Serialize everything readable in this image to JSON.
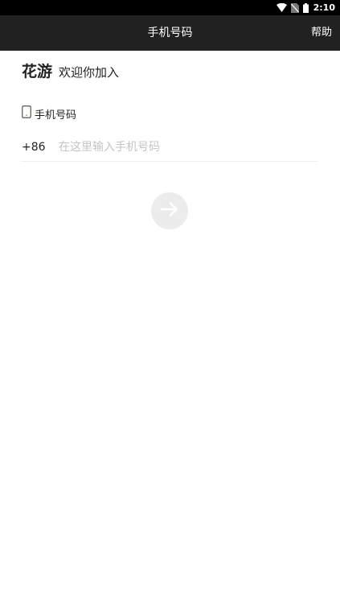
{
  "status_bar": {
    "time": "2:10",
    "icons": [
      "wifi-icon",
      "no-sim-icon",
      "battery-icon"
    ]
  },
  "nav": {
    "title": "手机号码",
    "help_label": "帮助",
    "background": "#212121"
  },
  "welcome": {
    "brand": "花游",
    "text": "欢迎你加入"
  },
  "phone_field": {
    "label": "手机号码",
    "icon": "phone-icon",
    "country_code": "+86",
    "placeholder": "在这里输入手机号码",
    "value": ""
  },
  "next_button": {
    "icon": "arrow-right-icon",
    "enabled": false,
    "background": "#ececec"
  }
}
